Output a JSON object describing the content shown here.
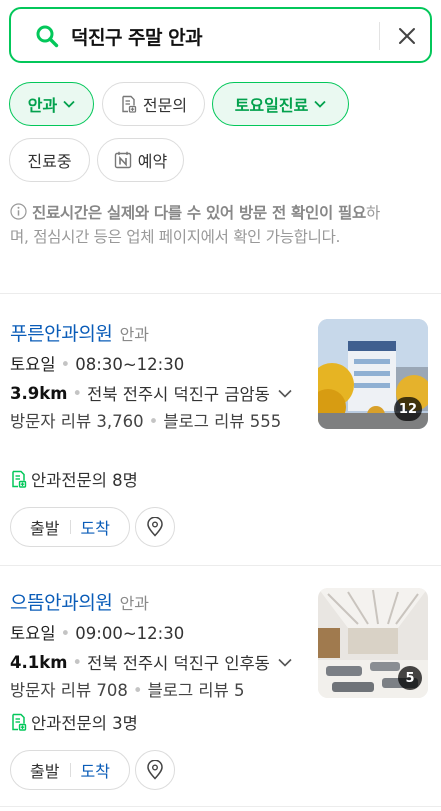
{
  "search": {
    "query": "덕진구 주말 안과"
  },
  "filters": [
    {
      "label": "안과",
      "active": true,
      "dropdown": true
    },
    {
      "label": "전문의",
      "active": false,
      "icon": "specialist-doc-icon"
    },
    {
      "label": "토요일진료",
      "active": true,
      "dropdown": true
    },
    {
      "label": "진료중",
      "active": false
    },
    {
      "label": "예약",
      "active": false,
      "icon": "naver-reserve-icon"
    }
  ],
  "notice": {
    "bold": "진료시간은 실제와 다를 수 있어 방문 전 확인이 필요",
    "rest": "하며, 점심시간 등은 업체 페이지에서 확인 가능합니다."
  },
  "results": [
    {
      "name": "푸른안과의원",
      "category": "안과",
      "day": "토요일",
      "time": "08:30~12:30",
      "distance": "3.9km",
      "address": "전북 전주시 덕진구 금암동",
      "visitor_reviews": "방문자 리뷰 3,760",
      "blog_reviews": "블로그 리뷰 555",
      "specialists": "안과전문의 8명",
      "photo_count": "12",
      "route_start": "출발",
      "route_arrive": "도착"
    },
    {
      "name": "으뜸안과의원",
      "category": "안과",
      "day": "토요일",
      "time": "09:00~12:30",
      "distance": "4.1km",
      "address": "전북 전주시 덕진구 인후동",
      "visitor_reviews": "방문자 리뷰 708",
      "blog_reviews": "블로그 리뷰 5",
      "specialists": "안과전문의 3명",
      "photo_count": "5",
      "route_start": "출발",
      "route_arrive": "도착"
    }
  ],
  "colors": {
    "accent": "#03c75a",
    "link": "#0a5cb8"
  }
}
